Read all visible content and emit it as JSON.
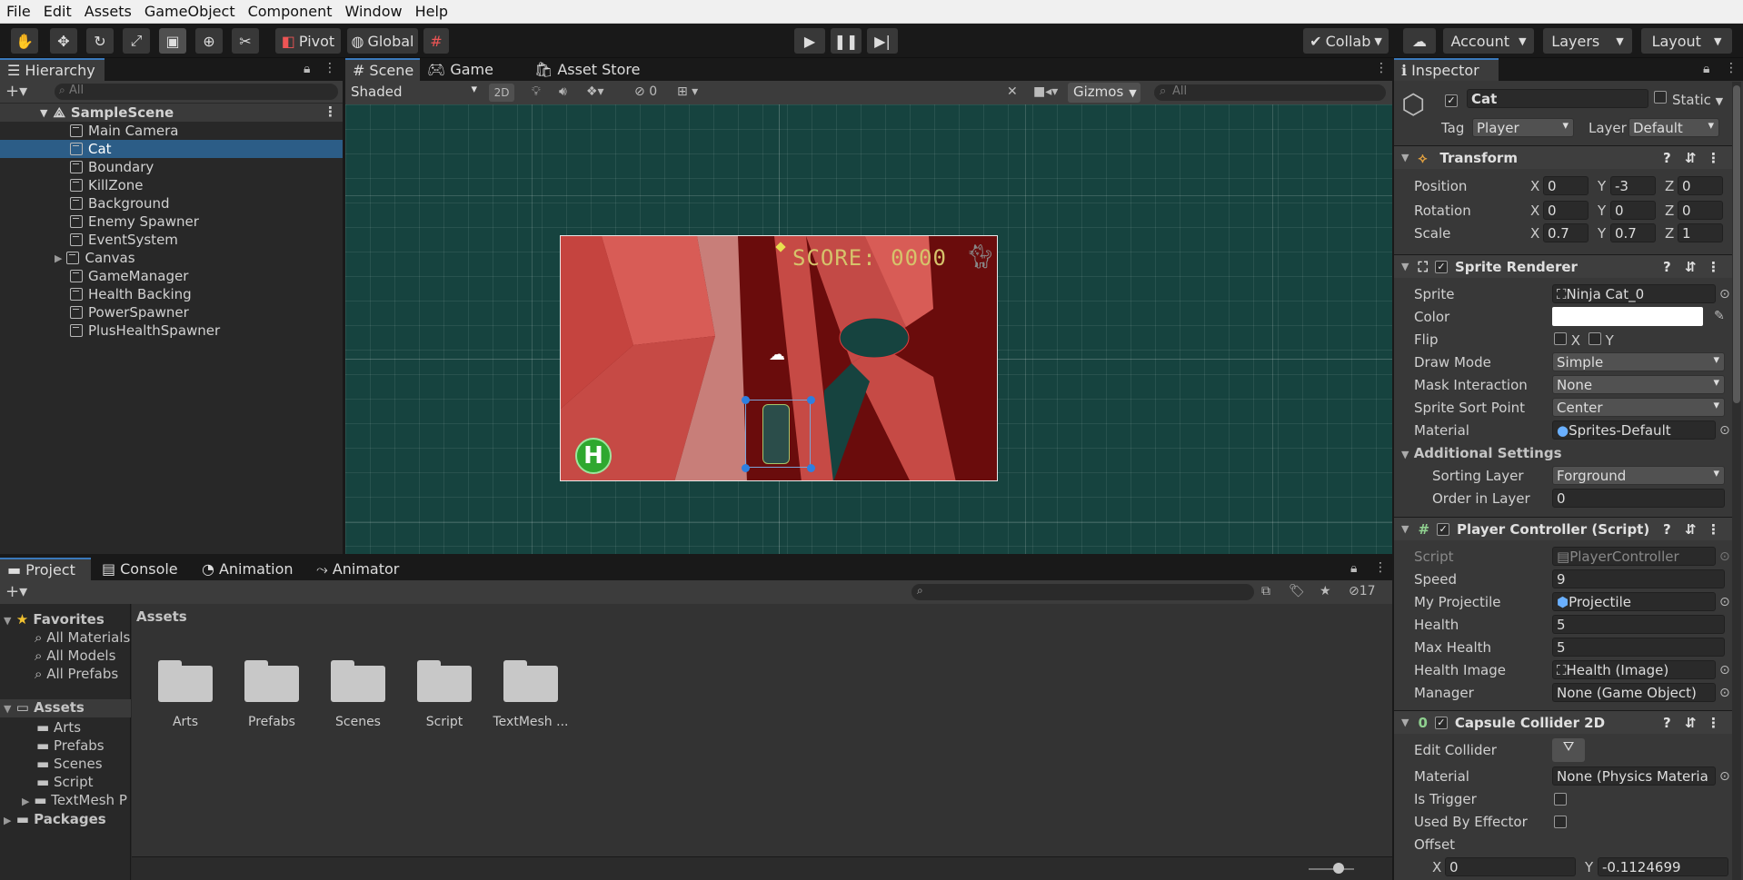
{
  "menu": [
    "File",
    "Edit",
    "Assets",
    "GameObject",
    "Component",
    "Window",
    "Help"
  ],
  "toolbar": {
    "pivot": "Pivot",
    "global": "Global",
    "collab": "Collab",
    "account": "Account",
    "layers": "Layers",
    "layout": "Layout"
  },
  "hierarchy": {
    "tab": "Hierarchy",
    "search_placeholder": "All",
    "scene": "SampleScene",
    "items": [
      "Main Camera",
      "Cat",
      "Boundary",
      "KillZone",
      "Background",
      "Enemy Spawner",
      "EventSystem",
      "Canvas",
      "GameManager",
      "Health Backing",
      "PowerSpawner",
      "PlusHealthSpawner"
    ]
  },
  "scene": {
    "tabs": [
      "Scene",
      "Game",
      "Asset Store"
    ],
    "shading": "Shaded",
    "mode2d": "2D",
    "hidden_count": "0",
    "gizmos": "Gizmos",
    "search_placeholder": "All",
    "score_text": "SCORE: 0000",
    "health_letter": "H"
  },
  "project": {
    "tabs": [
      "Project",
      "Console",
      "Animation",
      "Animator"
    ],
    "hidden_count": "17",
    "favorites": "Favorites",
    "fav_items": [
      "All Materials",
      "All Models",
      "All Prefabs"
    ],
    "assets": "Assets",
    "asset_items": [
      "Arts",
      "Prefabs",
      "Scenes",
      "Script",
      "TextMesh P"
    ],
    "packages": "Packages",
    "breadcrumb": "Assets",
    "folders": [
      "Arts",
      "Prefabs",
      "Scenes",
      "Script",
      "TextMesh ..."
    ]
  },
  "inspector": {
    "tab": "Inspector",
    "name": "Cat",
    "static": "Static",
    "tag_label": "Tag",
    "tag": "Player",
    "layer_label": "Layer",
    "layer": "Default",
    "transform": {
      "title": "Transform",
      "position": "Position",
      "rotation": "Rotation",
      "scale": "Scale",
      "pos": [
        "0",
        "-3",
        "0"
      ],
      "rot": [
        "0",
        "0",
        "0"
      ],
      "scl": [
        "0.7",
        "0.7",
        "1"
      ]
    },
    "sprite_renderer": {
      "title": "Sprite Renderer",
      "sprite_label": "Sprite",
      "sprite": "Ninja Cat_0",
      "color_label": "Color",
      "flip_label": "Flip",
      "draw_mode_label": "Draw Mode",
      "draw_mode": "Simple",
      "mask_label": "Mask Interaction",
      "mask": "None",
      "sort_point_label": "Sprite Sort Point",
      "sort_point": "Center",
      "material_label": "Material",
      "material": "Sprites-Default",
      "additional": "Additional Settings",
      "sorting_layer_label": "Sorting Layer",
      "sorting_layer": "Forground",
      "order_label": "Order in Layer",
      "order": "0"
    },
    "player_controller": {
      "title": "Player Controller (Script)",
      "script_label": "Script",
      "script": "PlayerController",
      "speed_label": "Speed",
      "speed": "9",
      "proj_label": "My Projectile",
      "proj": "Projectile",
      "health_label": "Health",
      "health": "5",
      "max_label": "Max Health",
      "max": "5",
      "himg_label": "Health Image",
      "himg": "Health (Image)",
      "manager_label": "Manager",
      "manager": "None (Game Object)"
    },
    "capsule": {
      "title": "Capsule Collider 2D",
      "edit_label": "Edit Collider",
      "material_label": "Material",
      "material": "None (Physics Materia",
      "trigger_label": "Is Trigger",
      "effector_label": "Used By Effector",
      "offset_label": "Offset",
      "offset_x": "0",
      "offset_y": "-0.1124699"
    }
  }
}
